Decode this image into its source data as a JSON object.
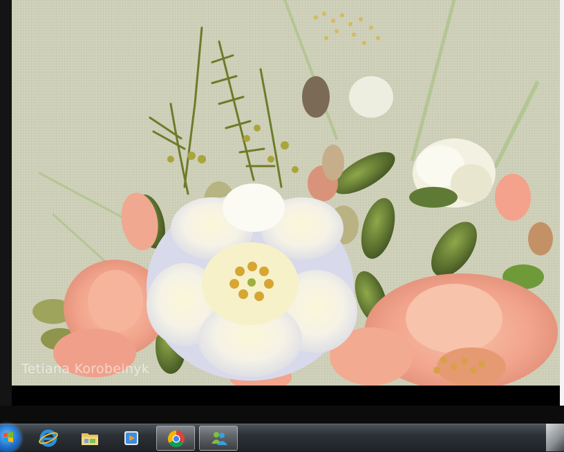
{
  "photo": {
    "watermark": "Tetiana Korobeinyk",
    "colors": {
      "linen": "#cfcfb8",
      "peach": "#f2a48c",
      "cream": "#f3f1e2",
      "leaf": "#5f7a34"
    }
  },
  "taskbar": {
    "start": {
      "icon": "windows-start-orb-icon"
    },
    "buttons": [
      {
        "icon": "internet-explorer-icon",
        "active": false
      },
      {
        "icon": "file-explorer-icon",
        "active": false
      },
      {
        "icon": "media-player-icon",
        "active": false
      },
      {
        "icon": "chrome-icon",
        "active": true
      },
      {
        "icon": "windows-live-messenger-icon",
        "active": true
      }
    ]
  }
}
